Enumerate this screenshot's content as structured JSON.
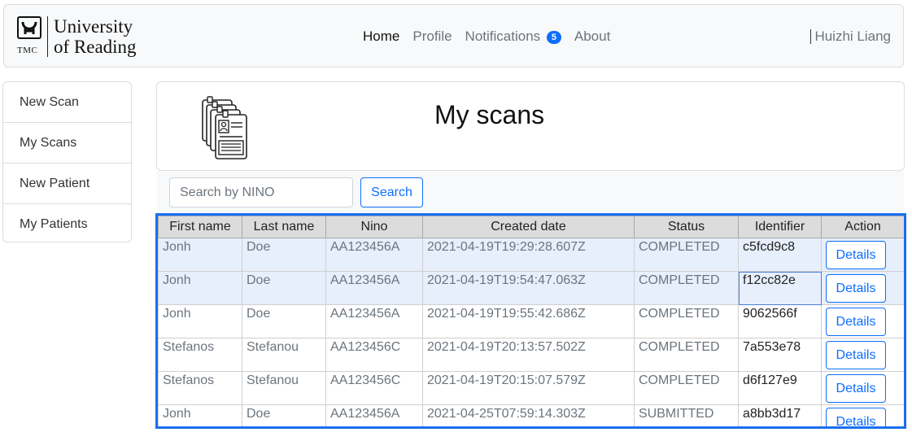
{
  "navbar": {
    "logo_line1": "University",
    "logo_line2": "of Reading",
    "logo_mark_text": "TMC",
    "links": [
      {
        "label": "Home",
        "active": true
      },
      {
        "label": "Profile",
        "active": false
      },
      {
        "label": "Notifications",
        "active": false
      },
      {
        "label": "About",
        "active": false
      }
    ],
    "notification_count": "5",
    "user_name": "Huizhi Liang"
  },
  "sidebar": {
    "items": [
      {
        "label": "New Scan"
      },
      {
        "label": "My Scans"
      },
      {
        "label": "New Patient"
      },
      {
        "label": "My Patients"
      }
    ]
  },
  "page": {
    "title": "My scans",
    "icon": "document-stack-icon"
  },
  "search": {
    "placeholder": "Search by NINO",
    "value": "",
    "button_label": "Search"
  },
  "table": {
    "headers": [
      "First name",
      "Last name",
      "Nino",
      "Created date",
      "Status",
      "Identifier",
      "Action"
    ],
    "rows": [
      {
        "first": "Jonh",
        "last": "Doe",
        "nino": "AA123456A",
        "created": "2021-04-19T19:29:28.607Z",
        "status": "COMPLETED",
        "identifier": "c5fcd9c8",
        "action": "Details"
      },
      {
        "first": "Jonh",
        "last": "Doe",
        "nino": "AA123456A",
        "created": "2021-04-19T19:54:47.063Z",
        "status": "COMPLETED",
        "identifier": "f12cc82e",
        "action": "Details"
      },
      {
        "first": "Jonh",
        "last": "Doe",
        "nino": "AA123456A",
        "created": "2021-04-19T19:55:42.686Z",
        "status": "COMPLETED",
        "identifier": "9062566f",
        "action": "Details"
      },
      {
        "first": "Stefanos",
        "last": "Stefanou",
        "nino": "AA123456C",
        "created": "2021-04-19T20:13:57.502Z",
        "status": "COMPLETED",
        "identifier": "7a553e78",
        "action": "Details"
      },
      {
        "first": "Stefanos",
        "last": "Stefanou",
        "nino": "AA123456C",
        "created": "2021-04-19T20:15:07.579Z",
        "status": "COMPLETED",
        "identifier": "d6f127e9",
        "action": "Details"
      },
      {
        "first": "Jonh",
        "last": "Doe",
        "nino": "AA123456A",
        "created": "2021-04-25T07:59:14.303Z",
        "status": "SUBMITTED",
        "identifier": "a8bb3d17",
        "action": "Details"
      }
    ]
  },
  "colors": {
    "accent": "#0d6efd",
    "selection_border": "#1a6ff0",
    "selected_row": "#e7effc"
  }
}
